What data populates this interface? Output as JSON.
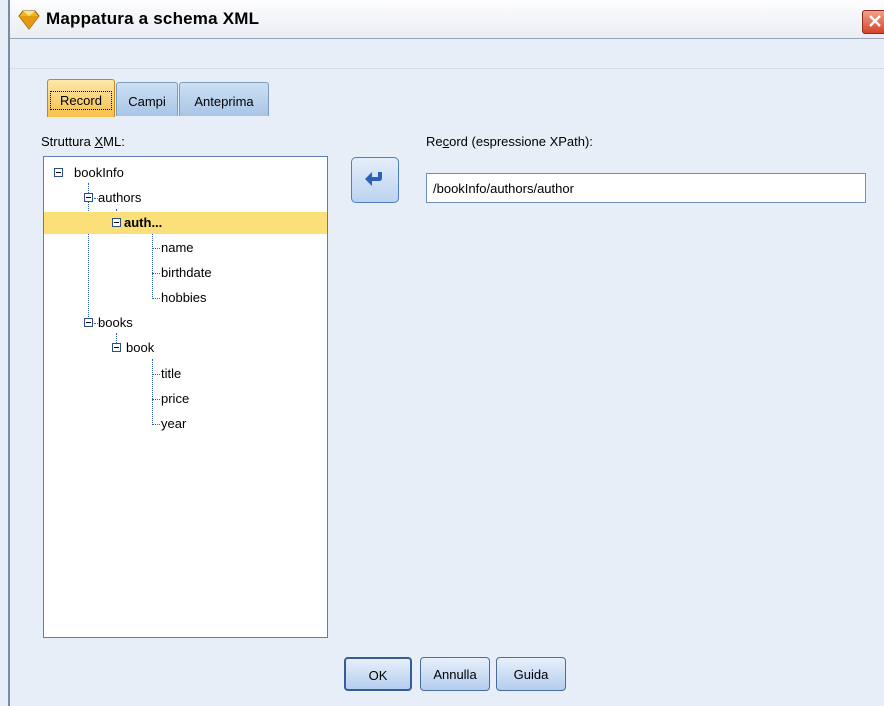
{
  "window": {
    "title": "Mappatura a schema XML"
  },
  "tabs": [
    {
      "label": "Record",
      "active": true
    },
    {
      "label": "Campi",
      "active": false
    },
    {
      "label": "Anteprima",
      "active": false
    }
  ],
  "structure": {
    "label_pre": "Struttura ",
    "label_u": "X",
    "label_post": "ML:"
  },
  "tree": [
    {
      "label": "bookInfo",
      "expanded": true
    },
    {
      "label": "authors",
      "expanded": true
    },
    {
      "label": "auth...",
      "expanded": true,
      "selected": true
    },
    {
      "label": "name"
    },
    {
      "label": "birthdate"
    },
    {
      "label": "hobbies"
    },
    {
      "label": "books",
      "expanded": true
    },
    {
      "label": "book",
      "expanded": true
    },
    {
      "label": "title"
    },
    {
      "label": "price"
    },
    {
      "label": "year"
    }
  ],
  "record": {
    "label_pre": "Re",
    "label_u": "c",
    "label_post": "ord (espressione XPath):",
    "value": "/bookInfo/authors/author"
  },
  "buttons": {
    "ok": "OK",
    "cancel": "Annulla",
    "help": "Guida"
  },
  "icons": {
    "app": "gem-icon",
    "close": "close-icon",
    "arrow": "arrow-left-icon"
  },
  "colors": {
    "selection": "#fbe07a",
    "active_tab": "#f6c04c",
    "tree_lines": "#2a5fbf"
  }
}
